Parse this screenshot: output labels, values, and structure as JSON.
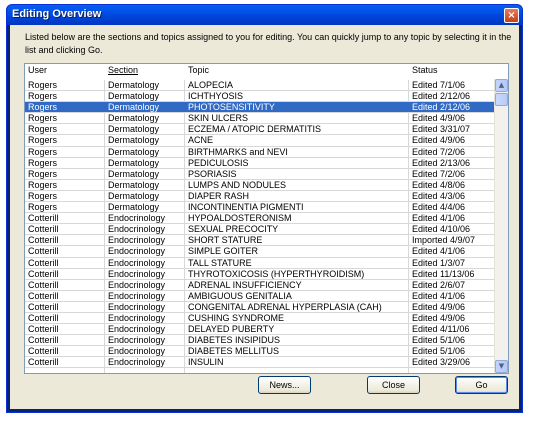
{
  "window": {
    "title": "Editing Overview",
    "close_glyph": "×"
  },
  "intro_text": "Listed below are the sections and topics assigned to you for editing.  You can quickly jump to any topic by selecting it in the list and clicking Go.",
  "columns": {
    "user": "User",
    "section": "Section",
    "topic": "Topic",
    "status": "Status"
  },
  "rows": [
    {
      "user": "Rogers",
      "section": "Dermatology",
      "topic": "ALOPECIA",
      "status": "Edited 7/1/06"
    },
    {
      "user": "Rogers",
      "section": "Dermatology",
      "topic": "ICHTHYOSIS",
      "status": "Edited 2/12/06"
    },
    {
      "user": "Rogers",
      "section": "Dermatology",
      "topic": "PHOTOSENSITIVITY",
      "status": "Edited 2/12/06"
    },
    {
      "user": "Rogers",
      "section": "Dermatology",
      "topic": "SKIN ULCERS",
      "status": "Edited 4/9/06"
    },
    {
      "user": "Rogers",
      "section": "Dermatology",
      "topic": "ECZEMA / ATOPIC DERMATITIS",
      "status": "Edited 3/31/07"
    },
    {
      "user": "Rogers",
      "section": "Dermatology",
      "topic": "ACNE",
      "status": "Edited 4/9/06"
    },
    {
      "user": "Rogers",
      "section": "Dermatology",
      "topic": "BIRTHMARKS and NEVI",
      "status": "Edited 7/2/06"
    },
    {
      "user": "Rogers",
      "section": "Dermatology",
      "topic": "PEDICULOSIS",
      "status": "Edited 2/13/06"
    },
    {
      "user": "Rogers",
      "section": "Dermatology",
      "topic": "PSORIASIS",
      "status": "Edited 7/2/06"
    },
    {
      "user": "Rogers",
      "section": "Dermatology",
      "topic": "LUMPS AND NODULES",
      "status": "Edited 4/8/06"
    },
    {
      "user": "Rogers",
      "section": "Dermatology",
      "topic": "DIAPER RASH",
      "status": "Edited 4/3/06"
    },
    {
      "user": "Rogers",
      "section": "Dermatology",
      "topic": "INCONTINENTIA PIGMENTI",
      "status": "Edited 4/4/06"
    },
    {
      "user": "Cotterill",
      "section": "Endocrinology",
      "topic": "HYPOALDOSTERONISM",
      "status": "Edited 4/1/06"
    },
    {
      "user": "Cotterill",
      "section": "Endocrinology",
      "topic": "SEXUAL PRECOCITY",
      "status": "Edited 4/10/06"
    },
    {
      "user": "Cotterill",
      "section": "Endocrinology",
      "topic": "SHORT STATURE",
      "status": "Imported 4/9/07"
    },
    {
      "user": "Cotterill",
      "section": "Endocrinology",
      "topic": "SIMPLE GOITER",
      "status": "Edited 4/1/06"
    },
    {
      "user": "Cotterill",
      "section": "Endocrinology",
      "topic": "TALL STATURE",
      "status": "Edited 1/3/07"
    },
    {
      "user": "Cotterill",
      "section": "Endocrinology",
      "topic": "THYROTOXICOSIS (HYPERTHYROIDISM)",
      "status": "Edited 11/13/06"
    },
    {
      "user": "Cotterill",
      "section": "Endocrinology",
      "topic": "ADRENAL INSUFFICIENCY",
      "status": "Edited 2/6/07"
    },
    {
      "user": "Cotterill",
      "section": "Endocrinology",
      "topic": "AMBIGUOUS GENITALIA",
      "status": "Edited 4/1/06"
    },
    {
      "user": "Cotterill",
      "section": "Endocrinology",
      "topic": "CONGENITAL ADRENAL HYPERPLASIA (CAH)",
      "status": "Edited 4/9/06"
    },
    {
      "user": "Cotterill",
      "section": "Endocrinology",
      "topic": "CUSHING SYNDROME",
      "status": "Edited 4/9/06"
    },
    {
      "user": "Cotterill",
      "section": "Endocrinology",
      "topic": "DELAYED PUBERTY",
      "status": "Edited 4/11/06"
    },
    {
      "user": "Cotterill",
      "section": "Endocrinology",
      "topic": "DIABETES INSIPIDUS",
      "status": "Edited 5/1/06"
    },
    {
      "user": "Cotterill",
      "section": "Endocrinology",
      "topic": "DIABETES MELLITUS",
      "status": "Edited 5/1/06"
    },
    {
      "user": "Cotterill",
      "section": "Endocrinology",
      "topic": "INSULIN",
      "status": "Edited 3/29/06"
    }
  ],
  "selected_row_index": 2,
  "scrollbar": {
    "up_glyph": "▲",
    "down_glyph": "▼"
  },
  "buttons": {
    "news": "News...",
    "close": "Close",
    "go": "Go"
  },
  "colors": {
    "selection": "#316ac5",
    "titlebar": "#0054e3",
    "dialog_bg": "#ece9d8"
  }
}
